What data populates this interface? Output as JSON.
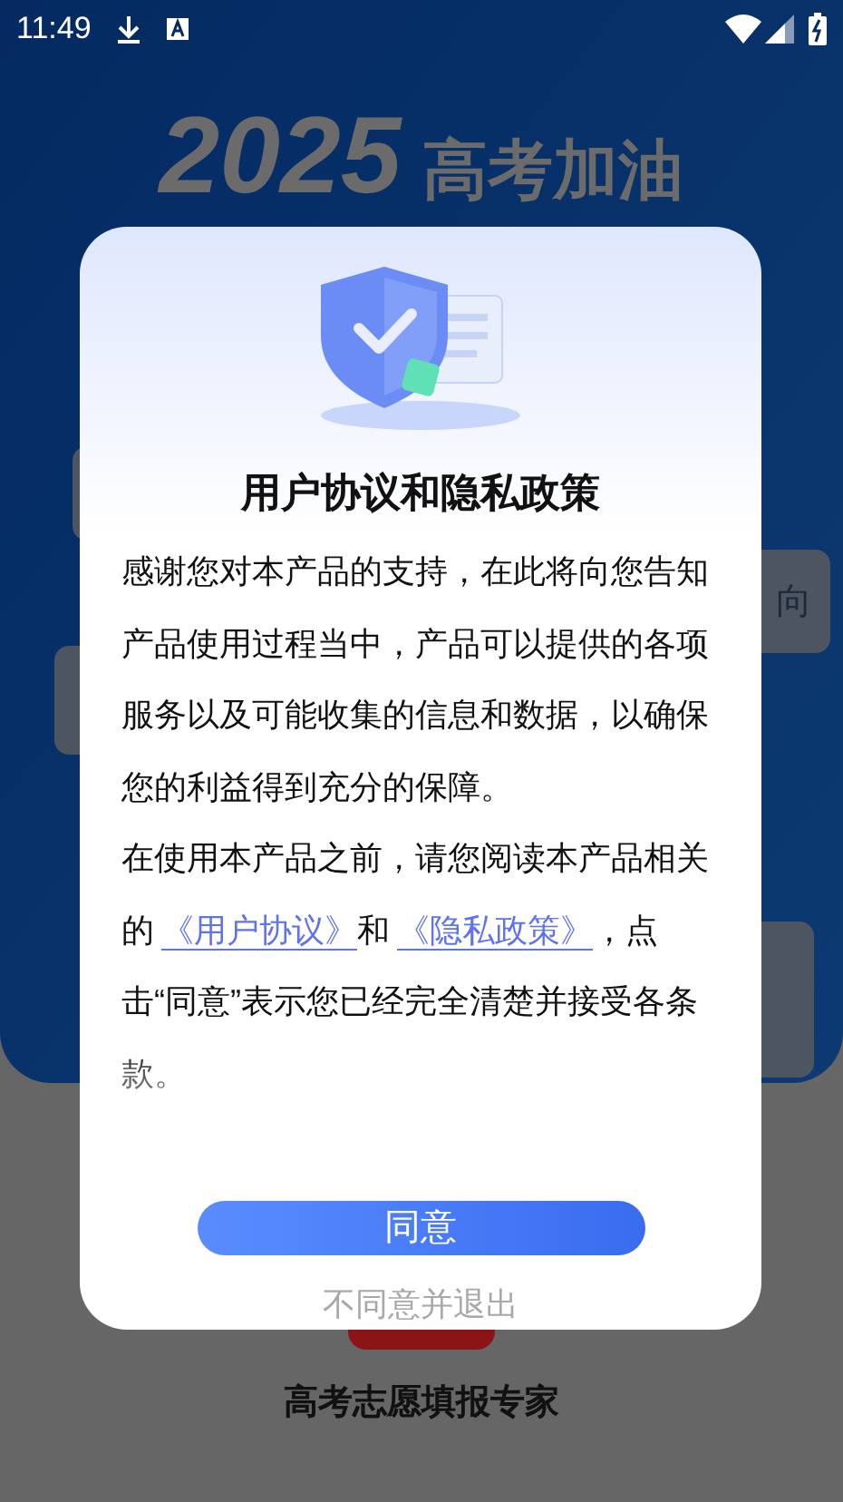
{
  "status_bar": {
    "time": "11:49"
  },
  "background": {
    "headline_year": "2025",
    "headline_text": "高考加油",
    "side_card_text": "向",
    "footer_title": "高考志愿填报专家"
  },
  "dialog": {
    "title": "用户协议和隐私政策",
    "intro": "感谢您对本产品的支持，在此将向您告知产品使用过程当中，产品可以提供的各项服务以及可能收集的信息和数据，以确保您的利益得到充分的保障。",
    "notice": [
      {
        "kind": "text",
        "text": "在使用本产品之前，请您阅读本产品相关的"
      },
      {
        "kind": "link",
        "text": "《用户协议》"
      },
      {
        "kind": "text",
        "text": "和"
      },
      {
        "kind": "link",
        "text": "《隐私政策》"
      },
      {
        "kind": "text",
        "text": "，点击“同意”表示您已经完全清楚并接受各条款。"
      }
    ],
    "agree_button": "同意",
    "decline_link": "不同意并退出"
  }
}
